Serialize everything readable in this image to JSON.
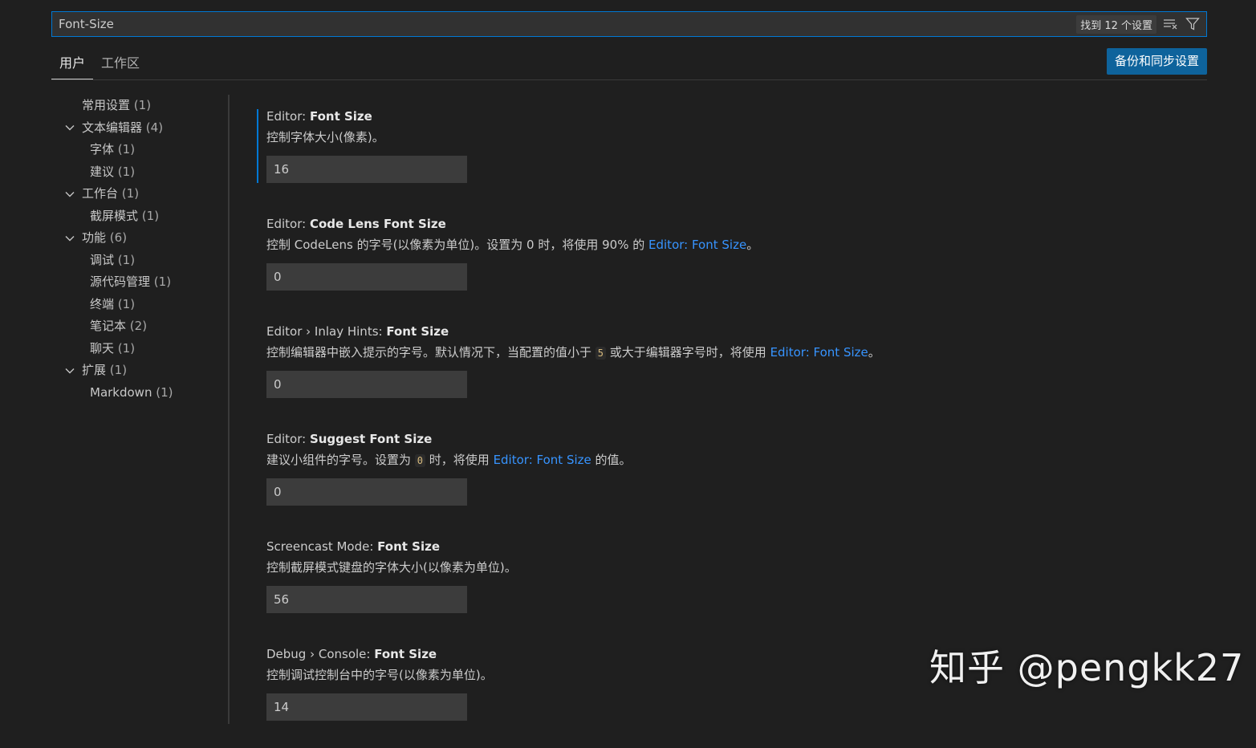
{
  "search": {
    "value": "Font-Size",
    "results_count": "找到 12 个设置"
  },
  "tabs": [
    {
      "label": "用户",
      "active": true
    },
    {
      "label": "工作区",
      "active": false
    }
  ],
  "sync_button": "备份和同步设置",
  "toc": [
    {
      "label": "常用设置",
      "count": "(1)",
      "level": 0,
      "expandable": false
    },
    {
      "label": "文本编辑器",
      "count": "(4)",
      "level": 0,
      "expandable": true
    },
    {
      "label": "字体",
      "count": "(1)",
      "level": 1,
      "expandable": false
    },
    {
      "label": "建议",
      "count": "(1)",
      "level": 1,
      "expandable": false
    },
    {
      "label": "工作台",
      "count": "(1)",
      "level": 0,
      "expandable": true
    },
    {
      "label": "截屏模式",
      "count": "(1)",
      "level": 1,
      "expandable": false
    },
    {
      "label": "功能",
      "count": "(6)",
      "level": 0,
      "expandable": true
    },
    {
      "label": "调试",
      "count": "(1)",
      "level": 1,
      "expandable": false
    },
    {
      "label": "源代码管理",
      "count": "(1)",
      "level": 1,
      "expandable": false
    },
    {
      "label": "终端",
      "count": "(1)",
      "level": 1,
      "expandable": false
    },
    {
      "label": "笔记本",
      "count": "(2)",
      "level": 1,
      "expandable": false
    },
    {
      "label": "聊天",
      "count": "(1)",
      "level": 1,
      "expandable": false
    },
    {
      "label": "扩展",
      "count": "(1)",
      "level": 0,
      "expandable": true
    },
    {
      "label": "Markdown",
      "count": "(1)",
      "level": 1,
      "expandable": false
    }
  ],
  "settings": [
    {
      "category": "Editor: ",
      "key": "Font Size",
      "desc_parts": [
        {
          "t": "text",
          "v": "控制字体大小(像素)。"
        }
      ],
      "value": "16"
    },
    {
      "category": "Editor: ",
      "key": "Code Lens Font Size",
      "desc_parts": [
        {
          "t": "text",
          "v": "控制 CodeLens 的字号(以像素为单位)。设置为 0 时，将使用 90% 的 "
        },
        {
          "t": "link",
          "v": "Editor: Font Size"
        },
        {
          "t": "text",
          "v": "。"
        }
      ],
      "value": "0"
    },
    {
      "category": "Editor › Inlay Hints: ",
      "key": "Font Size",
      "desc_parts": [
        {
          "t": "text",
          "v": "控制编辑器中嵌入提示的字号。默认情况下，当配置的值小于 "
        },
        {
          "t": "code",
          "v": "5"
        },
        {
          "t": "text",
          "v": " 或大于编辑器字号时，将使用 "
        },
        {
          "t": "link",
          "v": "Editor: Font Size"
        },
        {
          "t": "text",
          "v": "。"
        }
      ],
      "value": "0"
    },
    {
      "category": "Editor: ",
      "key": "Suggest Font Size",
      "desc_parts": [
        {
          "t": "text",
          "v": "建议小组件的字号。设置为 "
        },
        {
          "t": "code",
          "v": "0"
        },
        {
          "t": "text",
          "v": " 时，将使用 "
        },
        {
          "t": "link",
          "v": "Editor: Font Size"
        },
        {
          "t": "text",
          "v": " 的值。"
        }
      ],
      "value": "0"
    },
    {
      "category": "Screencast Mode: ",
      "key": "Font Size",
      "desc_parts": [
        {
          "t": "text",
          "v": "控制截屏模式键盘的字体大小(以像素为单位)。"
        }
      ],
      "value": "56"
    },
    {
      "category": "Debug › Console: ",
      "key": "Font Size",
      "desc_parts": [
        {
          "t": "text",
          "v": "控制调试控制台中的字号(以像素为单位)。"
        }
      ],
      "value": "14"
    }
  ],
  "watermark": "知乎 @pengkk27",
  "colors": {
    "background": "#1f1f1f",
    "accent": "#0078d4",
    "button": "#0e639c",
    "link": "#3794ff"
  },
  "icons": {
    "clear_filter": "clear-filter-icon",
    "filter": "filter-icon",
    "chevron": "chevron-down-icon"
  }
}
